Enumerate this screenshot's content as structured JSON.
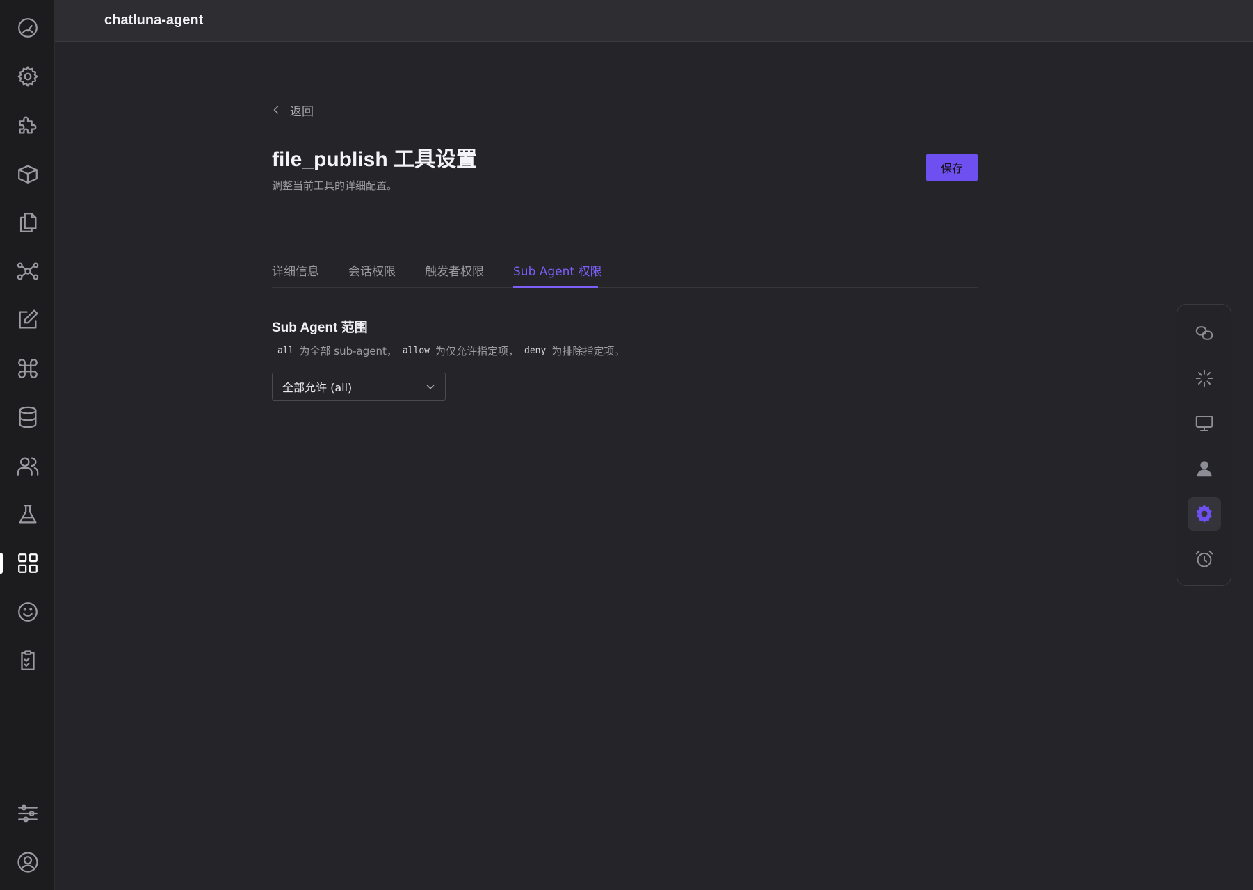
{
  "topbar": {
    "title": "chatluna-agent"
  },
  "activity_bar": {
    "items": [
      {
        "icon": "dashboard-gauge-icon",
        "active": false
      },
      {
        "icon": "gear-icon",
        "active": false
      },
      {
        "icon": "puzzle-icon",
        "active": false
      },
      {
        "icon": "package-box-icon",
        "active": false
      },
      {
        "icon": "files-icon",
        "active": false
      },
      {
        "icon": "network-graph-icon",
        "active": false
      },
      {
        "icon": "edit-icon",
        "active": false
      },
      {
        "icon": "command-icon",
        "active": false
      },
      {
        "icon": "database-icon",
        "active": false
      },
      {
        "icon": "users-icon",
        "active": false
      },
      {
        "icon": "flask-icon",
        "active": false
      },
      {
        "icon": "apps-grid-icon",
        "active": true
      },
      {
        "icon": "smiley-icon",
        "active": false
      },
      {
        "icon": "clipboard-check-icon",
        "active": false
      },
      {
        "icon": "sliders-icon",
        "active": false
      },
      {
        "icon": "account-icon",
        "active": false
      }
    ]
  },
  "main": {
    "back_label": "返回",
    "title": "file_publish 工具设置",
    "subtitle": "调整当前工具的详细配置。",
    "save_label": "保存",
    "tabs": [
      {
        "label": "详细信息",
        "active": false
      },
      {
        "label": "会话权限",
        "active": false
      },
      {
        "label": "触发者权限",
        "active": false
      },
      {
        "label": "Sub Agent 权限",
        "active": true
      }
    ],
    "section": {
      "title": "Sub Agent 范围",
      "desc": {
        "code_all": "all",
        "text_1": "为全部 sub-agent，",
        "code_allow": "allow",
        "text_2": "为仅允许指定项，",
        "code_deny": "deny",
        "text_3": "为排除指定项。"
      },
      "select_value": "全部允许 (all)"
    }
  },
  "right_panel": {
    "items": [
      {
        "icon": "link-chain-icon",
        "active": false
      },
      {
        "icon": "loading-spinner-icon",
        "active": false
      },
      {
        "icon": "monitor-icon",
        "active": false
      },
      {
        "icon": "person-icon",
        "active": false
      },
      {
        "icon": "settings-cog-icon",
        "active": true
      },
      {
        "icon": "alarm-clock-icon",
        "active": false
      }
    ]
  },
  "colors": {
    "accent": "#6e4ff0",
    "background": "#252429",
    "sidebar": "#1c1c1f"
  }
}
